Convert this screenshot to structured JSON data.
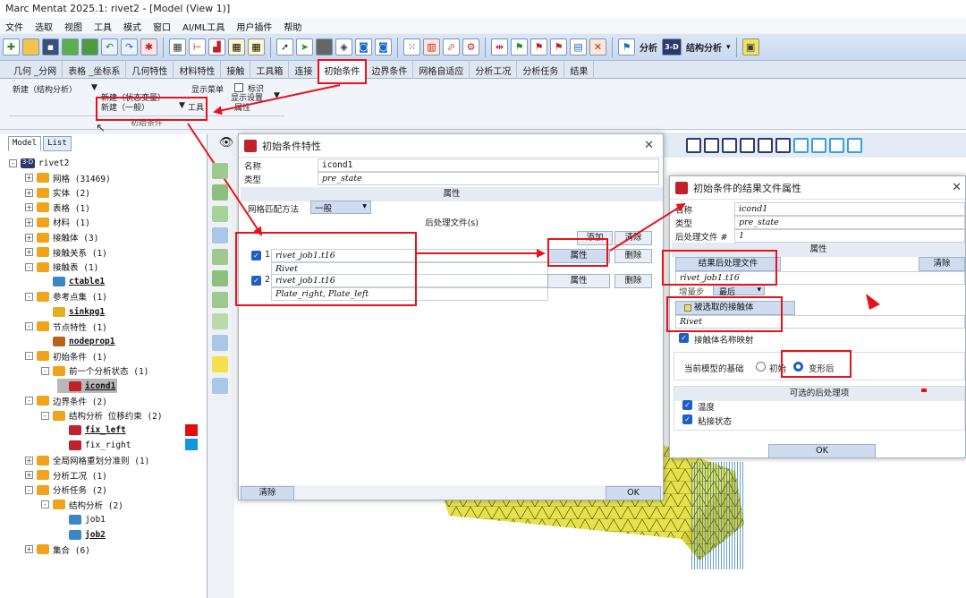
{
  "app": {
    "title": "Marc Mentat 2025.1: rivet2 - [Model (View 1)]"
  },
  "menu": [
    "文件",
    "选取",
    "视图",
    "工具",
    "模式",
    "窗口",
    "AI/ML工具",
    "用户插件",
    "帮助"
  ],
  "toolbar": {
    "analysis_label": "分析",
    "view_3d": "3-D",
    "struct_label": "结构分析"
  },
  "tabs": [
    "几何 _分网",
    "表格 _坐标系",
    "几何特性",
    "材料特性",
    "接触",
    "工具箱",
    "连接",
    "初始条件",
    "边界条件",
    "网格自适应",
    "分析工况",
    "分析任务",
    "结果"
  ],
  "ribbon": {
    "new_struct": "新建（结构分析）",
    "new_state": "新建（状态变量）",
    "new_general": "新建（一般）",
    "show_menu": "显示菜单",
    "tools": "工具",
    "mark": "标识",
    "show_settings": "显示设置",
    "properties": "属性",
    "group_label": "初始条件"
  },
  "panel": {
    "tab_model": "Model",
    "tab_list": "List"
  },
  "tree": [
    {
      "depth": 0,
      "toggle": "-",
      "label": "rivet2",
      "icon": "3d-icon",
      "bold": false
    },
    {
      "depth": 1,
      "toggle": "+",
      "label": "网格 (31469)",
      "icon": "mesh-icon",
      "bold": false
    },
    {
      "depth": 1,
      "toggle": "+",
      "label": "实体 (2)",
      "icon": "solid-icon",
      "bold": false
    },
    {
      "depth": 1,
      "toggle": "+",
      "label": "表格 (1)",
      "icon": "table-icon",
      "bold": false
    },
    {
      "depth": 1,
      "toggle": "+",
      "label": "材料 (1)",
      "icon": "material-icon",
      "bold": false
    },
    {
      "depth": 1,
      "toggle": "+",
      "label": "接触体 (3)",
      "icon": "contact-body-icon",
      "bold": false
    },
    {
      "depth": 1,
      "toggle": "+",
      "label": "接触关系 (1)",
      "icon": "contact-relation-icon",
      "bold": false
    },
    {
      "depth": 1,
      "toggle": "-",
      "label": "接触表 (1)",
      "icon": "contact-table-icon",
      "bold": false
    },
    {
      "depth": 2,
      "toggle": "",
      "label": "ctable1",
      "icon": "ctable-icon",
      "bold": true
    },
    {
      "depth": 1,
      "toggle": "-",
      "label": "参考点集 (1)",
      "icon": "ref-point-icon",
      "bold": false
    },
    {
      "depth": 2,
      "toggle": "",
      "label": "sinkpg1",
      "icon": "sink-icon",
      "bold": true
    },
    {
      "depth": 1,
      "toggle": "-",
      "label": "节点特性 (1)",
      "icon": "node-prop-icon",
      "bold": false
    },
    {
      "depth": 2,
      "toggle": "",
      "label": "nodeprop1",
      "icon": "cube-icon",
      "bold": true
    },
    {
      "depth": 1,
      "toggle": "-",
      "label": "初始条件 (1)",
      "icon": "initial-cond-icon",
      "bold": false
    },
    {
      "depth": 2,
      "toggle": "-",
      "label": "前一个分析状态 (1)",
      "icon": "prev-state-icon",
      "bold": false
    },
    {
      "depth": 3,
      "toggle": "",
      "label": "icond1",
      "icon": "icond-icon",
      "bold": true,
      "selected": true
    },
    {
      "depth": 1,
      "toggle": "-",
      "label": "边界条件 (2)",
      "icon": "boundary-icon",
      "bold": false
    },
    {
      "depth": 2,
      "toggle": "-",
      "label": "结构分析 位移约束 (2)",
      "icon": "structural-icon",
      "bold": false
    },
    {
      "depth": 3,
      "toggle": "",
      "label": "fix_left",
      "icon": "fix-icon",
      "bold": true,
      "swatch": "#e30d0d"
    },
    {
      "depth": 3,
      "toggle": "",
      "label": "fix_right",
      "icon": "fix-icon",
      "bold": false,
      "swatch": "#1196e0"
    },
    {
      "depth": 1,
      "toggle": "+",
      "label": "全局网格重划分准则 (1)",
      "icon": "remesh-icon",
      "bold": false
    },
    {
      "depth": 1,
      "toggle": "+",
      "label": "分析工况 (1)",
      "icon": "loadcase-icon",
      "bold": false
    },
    {
      "depth": 1,
      "toggle": "-",
      "label": "分析任务 (2)",
      "icon": "job-icon",
      "bold": false
    },
    {
      "depth": 2,
      "toggle": "-",
      "label": "结构分析 (2)",
      "icon": "structural-icon",
      "bold": false
    },
    {
      "depth": 3,
      "toggle": "",
      "label": "job1",
      "icon": "job-item-icon",
      "bold": false
    },
    {
      "depth": 3,
      "toggle": "",
      "label": "job2",
      "icon": "job-item-icon",
      "bold": true
    },
    {
      "depth": 1,
      "toggle": "+",
      "label": "集合 (6)",
      "icon": "set-icon",
      "bold": false
    }
  ],
  "dialog1": {
    "title": "初始条件特性",
    "name_label": "名称",
    "name_value": "icond1",
    "type_label": "类型",
    "type_value": "pre_state",
    "section_props": "属性",
    "mesh_match_label": "网格匹配方法",
    "mesh_match_value": "一般",
    "post_files_label": "后处理文件(s)",
    "add_btn": "添加",
    "clear_btn": "清除",
    "rows": [
      {
        "num": "1",
        "file": "rivet_job1.t16",
        "sub": "Rivet",
        "prop_btn": "属性",
        "del_btn": "删除"
      },
      {
        "num": "2",
        "file": "rivet_job1.t16",
        "sub": "Plate_right, Plate_left",
        "prop_btn": "属性",
        "del_btn": "删除"
      }
    ],
    "bottom_clear": "清除",
    "ok": "OK"
  },
  "dialog2": {
    "title": "初始条件的结果文件属性",
    "name_label": "名称",
    "name_value": "icond1",
    "type_label": "类型",
    "type_value": "pre_state",
    "post_label": "后处理文件 #",
    "post_value": "1",
    "section_props": "属性",
    "result_file_btn": "结果后处理文件",
    "clear_btn": "清除",
    "result_file_value": "rivet_job1.t16",
    "increment_label": "增量步",
    "increment_value": "最后",
    "selected_body_label": "被选取的接触体",
    "selected_body_value": "Rivet",
    "map_names_label": "接触体名称映射",
    "basis_label": "当前模型的基础",
    "opt_initial": "初始",
    "opt_deformed": "变形后",
    "optional_section": "可选的后处理项",
    "opt_temp": "温度",
    "opt_glue": "粘接状态",
    "ok": "OK"
  }
}
